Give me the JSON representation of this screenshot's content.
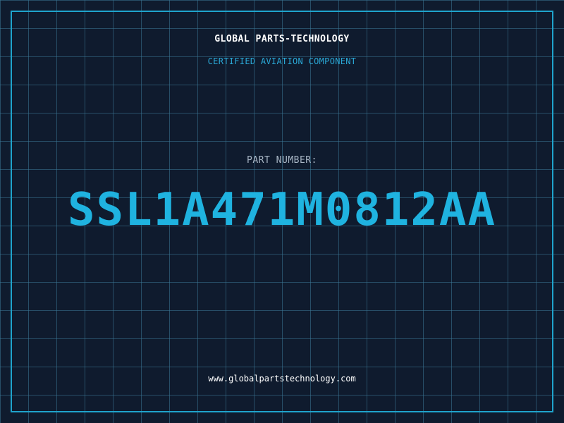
{
  "header": {
    "company_name": "GLOBAL PARTS-TECHNOLOGY",
    "tagline": "CERTIFIED AVIATION COMPONENT"
  },
  "part": {
    "label": "PART NUMBER:",
    "number": "SSL1A471M0812AA"
  },
  "footer": {
    "website": "www.globalpartstechnology.com"
  },
  "colors": {
    "background": "#0f1b2e",
    "grid": "#3a7896",
    "accent": "#1fb3e0",
    "frame": "#1fa4cc",
    "text_primary": "#ffffff",
    "text_muted": "#a9b7c6"
  }
}
